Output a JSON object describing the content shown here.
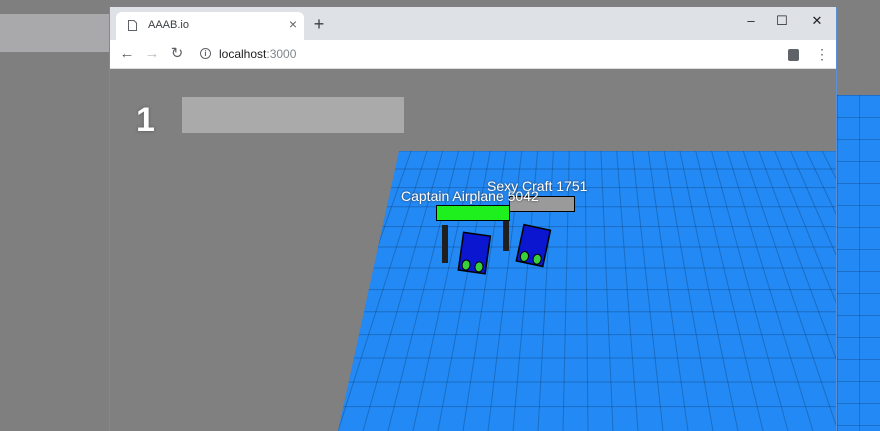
{
  "browser": {
    "tab_title": "AAAB.io",
    "tab_close": "×",
    "new_tab": "+",
    "minimize": "–",
    "maximize": "☐",
    "close": "✕",
    "back": "←",
    "forward": "→",
    "reload": "↻",
    "info": "i",
    "address_host": "localhost",
    "address_port": ":3000",
    "menu": "⋮"
  },
  "game": {
    "rank": "1",
    "players": [
      {
        "name": "Captain Airplane 5042",
        "health_fraction": 1.0,
        "bar_color": "#1ef01e"
      },
      {
        "name": "Sexy Craft 1751",
        "health_fraction": 1.0,
        "bar_color": "#9a9a9a"
      }
    ],
    "colors": {
      "field": "#2289f5",
      "background": "#808080",
      "vehicle": "#0a16d0",
      "wheel": "#39d039"
    }
  }
}
